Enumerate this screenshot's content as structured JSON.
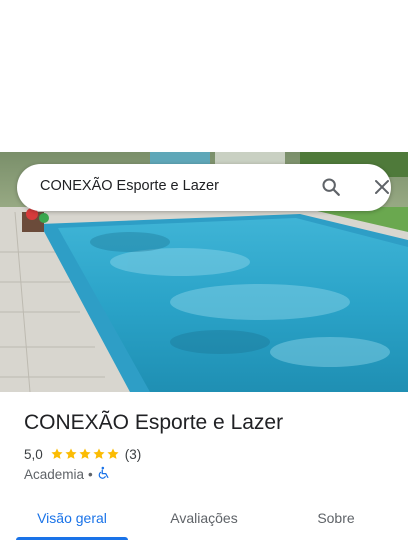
{
  "search": {
    "value": "CONEXÃO Esporte e Lazer"
  },
  "icons": {
    "search": "search-icon",
    "close": "close-icon",
    "wheelchair": "wheelchair-accessible-icon",
    "star": "star-icon"
  },
  "place": {
    "title": "CONEXÃO Esporte e Lazer",
    "rating": "5,0",
    "stars": 5,
    "review_count": "(3)",
    "category": "Academia",
    "separator": "•"
  },
  "tabs": [
    {
      "label": "Visão geral",
      "active": true
    },
    {
      "label": "Avaliações",
      "active": false
    },
    {
      "label": "Sobre",
      "active": false
    }
  ],
  "colors": {
    "accent": "#1a73e8",
    "star": "#fbbc04",
    "pool": "#3fb2d4"
  }
}
